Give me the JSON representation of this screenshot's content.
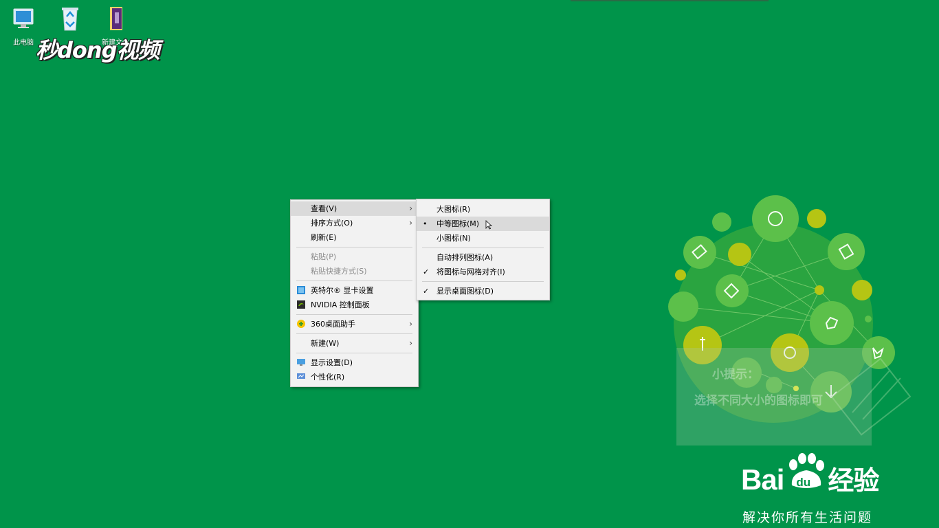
{
  "desktop": {
    "icons": [
      {
        "label": "此电脑",
        "icon": "computer-icon"
      },
      {
        "label": "",
        "icon": "recycle-bin-icon"
      },
      {
        "label": "新建文件",
        "icon": "folder-icon"
      }
    ],
    "watermark": "秒dong视频"
  },
  "context_menu": {
    "items": [
      {
        "label": "查看(V)",
        "submenu": true
      },
      {
        "label": "排序方式(O)",
        "submenu": true
      },
      {
        "label": "刷新(E)"
      },
      {
        "label": "粘贴(P)",
        "disabled": true
      },
      {
        "label": "粘贴快捷方式(S)",
        "disabled": true
      },
      {
        "label": "英特尔® 显卡设置",
        "icon": "intel-graphics-icon"
      },
      {
        "label": "NVIDIA 控制面板",
        "icon": "nvidia-icon"
      },
      {
        "label": "360桌面助手",
        "icon": "360-icon",
        "submenu": true
      },
      {
        "label": "新建(W)",
        "submenu": true
      },
      {
        "label": "显示设置(D)",
        "icon": "display-icon"
      },
      {
        "label": "个性化(R)",
        "icon": "personalize-icon"
      }
    ]
  },
  "view_submenu": {
    "items": [
      {
        "label": "大图标(R)"
      },
      {
        "label": "中等图标(M)",
        "mark": "•"
      },
      {
        "label": "小图标(N)"
      },
      {
        "label": "自动排列图标(A)"
      },
      {
        "label": "将图标与网格对齐(I)",
        "mark": "✓"
      },
      {
        "label": "显示桌面图标(D)",
        "mark": "✓"
      }
    ]
  },
  "tip": {
    "title": "小提示：",
    "text": "选择不同大小的图标即可"
  },
  "baidu": {
    "brand": "Bai",
    "brand_suffix": "经验",
    "paw_text": "du",
    "slogan": "解决你所有生活问题"
  },
  "colors": {
    "desktop_bg": "#00944a",
    "menu_bg": "#f2f2f2",
    "hover_bg": "#dadada",
    "bubble_green": "#5bbf3c",
    "bubble_yellow": "#b5c514"
  }
}
